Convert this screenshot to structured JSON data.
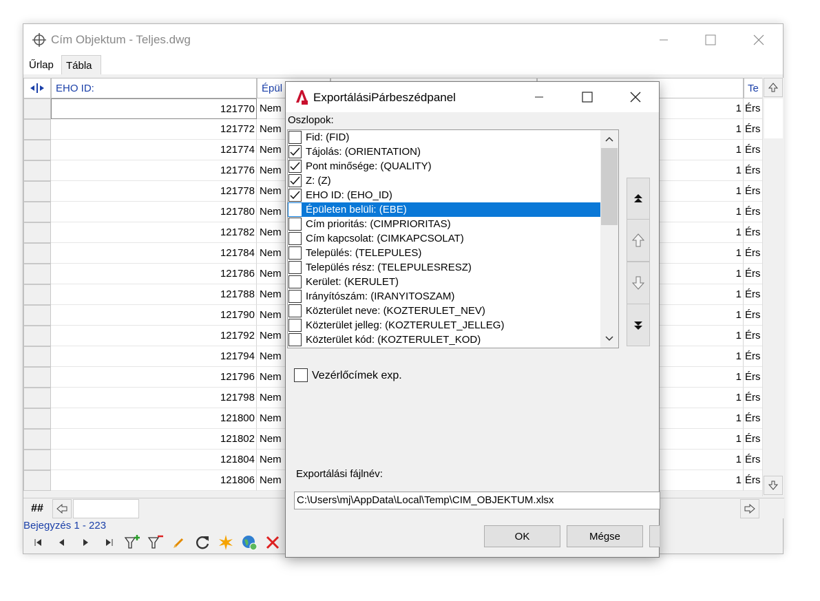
{
  "main_window": {
    "title": "Cím Objektum - Teljes.dwg",
    "tabs": [
      "Űrlap",
      "Tábla"
    ],
    "active_tab": "Tábla",
    "columns": [
      "EHO ID:",
      "Épül",
      "Te"
    ],
    "rows": [
      {
        "id": "121770",
        "c2": "Nem",
        "n": "1",
        "c4": "Érs"
      },
      {
        "id": "121772",
        "c2": "Nem",
        "n": "1",
        "c4": "Érs"
      },
      {
        "id": "121774",
        "c2": "Nem",
        "n": "1",
        "c4": "Érs"
      },
      {
        "id": "121776",
        "c2": "Nem",
        "n": "1",
        "c4": "Érs"
      },
      {
        "id": "121778",
        "c2": "Nem",
        "n": "1",
        "c4": "Érs"
      },
      {
        "id": "121780",
        "c2": "Nem",
        "n": "1",
        "c4": "Érs"
      },
      {
        "id": "121782",
        "c2": "Nem",
        "n": "1",
        "c4": "Érs"
      },
      {
        "id": "121784",
        "c2": "Nem",
        "n": "1",
        "c4": "Érs"
      },
      {
        "id": "121786",
        "c2": "Nem",
        "n": "1",
        "c4": "Érs"
      },
      {
        "id": "121788",
        "c2": "Nem",
        "n": "1",
        "c4": "Érs"
      },
      {
        "id": "121790",
        "c2": "Nem",
        "n": "1",
        "c4": "Érs"
      },
      {
        "id": "121792",
        "c2": "Nem",
        "n": "1",
        "c4": "Érs"
      },
      {
        "id": "121794",
        "c2": "Nem",
        "n": "1",
        "c4": "Érs"
      },
      {
        "id": "121796",
        "c2": "Nem",
        "n": "1",
        "c4": "Érs"
      },
      {
        "id": "121798",
        "c2": "Nem",
        "n": "1",
        "c4": "Érs"
      },
      {
        "id": "121800",
        "c2": "Nem",
        "n": "1",
        "c4": "Érs"
      },
      {
        "id": "121802",
        "c2": "Nem",
        "n": "1",
        "c4": "Érs"
      },
      {
        "id": "121804",
        "c2": "Nem",
        "n": "1",
        "c4": "Érs"
      },
      {
        "id": "121806",
        "c2": "Nem",
        "n": "1",
        "c4": "Érs"
      }
    ],
    "corner_label": "##",
    "status": "Bejegyzés 1 - 223",
    "toolbar_icons": [
      "first-icon",
      "prev-icon",
      "next-icon",
      "last-icon",
      "filter-add-icon",
      "filter-remove-icon",
      "edit-icon",
      "refresh-icon",
      "highlight-icon",
      "globe-icon",
      "delete-icon",
      "print-icon"
    ]
  },
  "dialog": {
    "title": "ExportálásiPárbeszédpanel",
    "columns_label": "Oszlopok:",
    "items": [
      {
        "label": "Fid: (FID)",
        "checked": false,
        "selected": false
      },
      {
        "label": "Tájolás: (ORIENTATION)",
        "checked": true,
        "selected": false
      },
      {
        "label": "Pont minősége: (QUALITY)",
        "checked": true,
        "selected": false
      },
      {
        "label": "Z: (Z)",
        "checked": true,
        "selected": false
      },
      {
        "label": "EHO ID: (EHO_ID)",
        "checked": true,
        "selected": false
      },
      {
        "label": "Épületen belüli: (EBE)",
        "checked": true,
        "selected": true
      },
      {
        "label": "Cím prioritás: (CIMPRIORITAS)",
        "checked": false,
        "selected": false
      },
      {
        "label": "Cím kapcsolat: (CIMKAPCSOLAT)",
        "checked": false,
        "selected": false
      },
      {
        "label": "Település: (TELEPULES)",
        "checked": false,
        "selected": false
      },
      {
        "label": "Település rész: (TELEPULESRESZ)",
        "checked": false,
        "selected": false
      },
      {
        "label": "Kerület: (KERULET)",
        "checked": false,
        "selected": false
      },
      {
        "label": "Irányítószám: (IRANYITOSZAM)",
        "checked": false,
        "selected": false
      },
      {
        "label": "Közterület neve: (KOZTERULET_NEV)",
        "checked": false,
        "selected": false
      },
      {
        "label": "Közterület jelleg: (KOZTERULET_JELLEG)",
        "checked": false,
        "selected": false
      },
      {
        "label": "Közterület kód: (KOZTERULET_KOD)",
        "checked": false,
        "selected": false
      }
    ],
    "export_headers_label": "Vezérlőcímek exp.",
    "export_headers_checked": false,
    "filename_label": "Exportálási fájlnév:",
    "filename_value": "C:\\Users\\mj\\AppData\\Local\\Temp\\CIM_OBJEKTUM.xlsx",
    "ok_label": "OK",
    "cancel_label": "Mégse"
  },
  "colors": {
    "selection": "#0a78d7",
    "header_text": "#1a3fa8"
  }
}
